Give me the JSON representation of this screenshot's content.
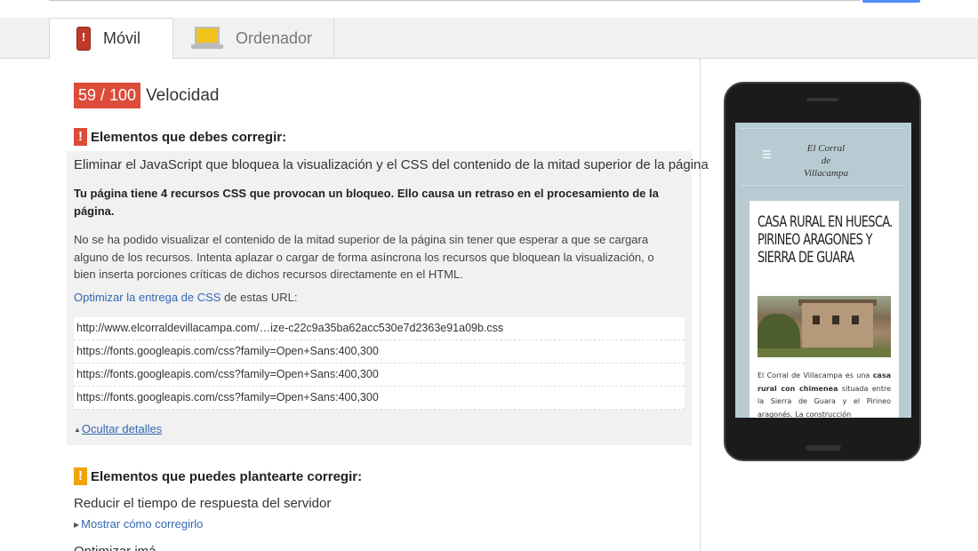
{
  "tabs": {
    "mobile_label": "Móvil",
    "desktop_label": "Ordenador"
  },
  "score": {
    "value": "59 / 100",
    "label": "Velocidad",
    "badge_color": "#dd4b39"
  },
  "must_fix": {
    "heading": "Elementos que debes corregir:",
    "rule_title": "Eliminar el JavaScript que bloquea la visualización y el CSS del contenido de la mitad superior de la página",
    "summary": "Tu página tiene 4 recursos CSS que provocan un bloqueo. Ello causa un retraso en el procesamiento de la página.",
    "description": "No se ha podido visualizar el contenido de la mitad superior de la página sin tener que esperar a que se cargara alguno de los recursos. Intenta aplazar o cargar de forma asíncrona los recursos que bloquean la visualización, o bien inserta porciones críticas de dichos recursos directamente en el HTML.",
    "optimize_link": "Optimizar la entrega de CSS",
    "optimize_suffix": " de estas URL:",
    "urls": [
      "http://www.elcorraldevillacampa.com/…ize-c22c9a35ba62acc530e7d2363e91a09b.css",
      "https://fonts.googleapis.com/css?family=Open+Sans:400,300",
      "https://fonts.googleapis.com/css?family=Open+Sans:400,300",
      "https://fonts.googleapis.com/css?family=Open+Sans:400,300"
    ],
    "hide_details": "Ocultar detalles"
  },
  "consider_fix": {
    "heading": "Elementos que puedes plantearte corregir:",
    "rule_title": "Reducir el tiempo de respuesta del servidor",
    "show_how": "Mostrar cómo corregirlo",
    "next_rule_partial": "Optimizar imá..."
  },
  "preview": {
    "site_logo_line1": "El Corral",
    "site_logo_line2": "de",
    "site_logo_line3": "Villacampa",
    "card_title": "CASA RURAL EN HUESCA. PIRINEO ARAGONES Y SIERRA DE GUARA",
    "text_pre": "El Corral de Villacampa es una ",
    "text_bold": "casa rural con chimenea",
    "text_post": " situada entre la Sierra de Guara y el Pirineo aragonés. La construcción"
  }
}
